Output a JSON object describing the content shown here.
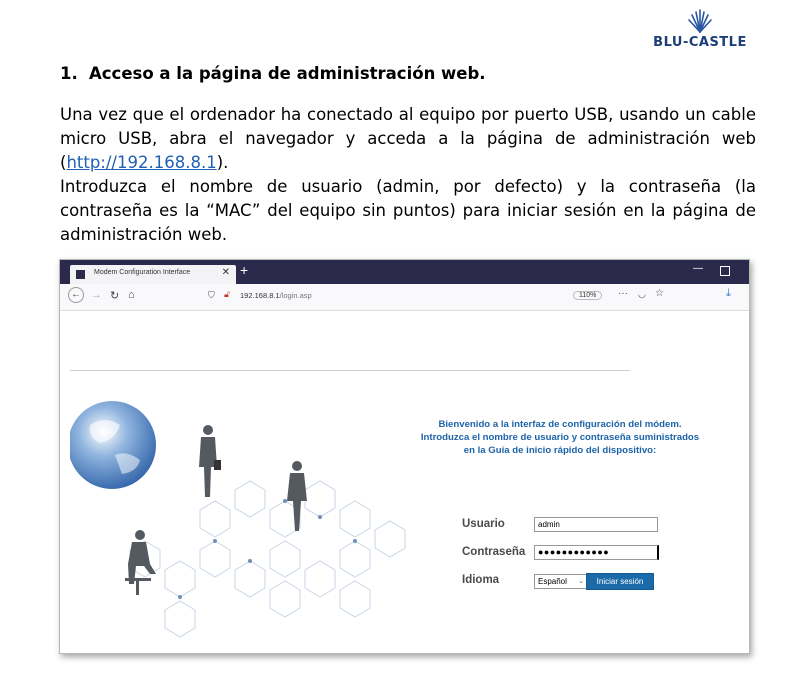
{
  "logo": {
    "text": "BLU-CASTLE"
  },
  "heading": {
    "number": "1.",
    "text": "Acceso a la página de administración web."
  },
  "paragraph1": {
    "before": "Una vez que el ordenador ha conectado al equipo por puerto USB, usando un cable micro USB, abra el navegador y acceda a la página de administración web (",
    "link": "http://192.168.8.1",
    "after": ")."
  },
  "paragraph2": "Introduzca el nombre de usuario (admin, por defecto) y la contraseña (la contraseña es la “MAC” del equipo sin puntos) para iniciar sesión en la página de administración web.",
  "browser": {
    "tab_title": "Modem Configuration Interface",
    "tab_close": "✕",
    "new_tab": "+",
    "url_host": "192.168.8.1",
    "url_path": "/login.asp",
    "zoom": "110%",
    "more": "···"
  },
  "login": {
    "welcome_line1": "Bienvenido a la interfaz de configuración del módem.",
    "welcome_line2": "Introduzca el nombre de usuario y contraseña suministrados",
    "welcome_line3": "en la Guía de inicio rápido del dispositivo:",
    "user_label": "Usuario",
    "user_value": "admin",
    "password_label": "Contraseña",
    "password_value": "●●●●●●●●●●●●",
    "language_label": "Idioma",
    "language_value": "Español",
    "login_button": "Iniciar sesión"
  },
  "colors": {
    "brand": "#1c3f7a",
    "welcome_text": "#1d63a8",
    "button": "#1a6aaa",
    "tabbar": "#2b2a4c"
  }
}
